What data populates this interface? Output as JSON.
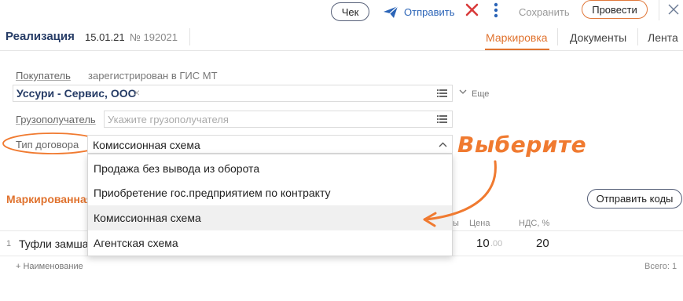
{
  "toolbar": {
    "check_label": "Чек",
    "send_label": "Отправить",
    "save_label": "Сохранить",
    "post_label": "Провести"
  },
  "doc": {
    "title": "Реализация",
    "date": "15.01.21",
    "number": "№ 192021"
  },
  "tabs": [
    "Маркировка",
    "Документы",
    "Лента"
  ],
  "form": {
    "buyer_label": "Покупатель",
    "buyer_status": "зарегистрирован в ГИС МТ",
    "buyer_value": "Уссури - Сервис, ООО",
    "more_label": "Еще",
    "consignee_label": "Грузополучатель",
    "consignee_placeholder": "Укажите грузополучателя",
    "contract_label": "Тип договора",
    "contract_value": "Комиссионная схема"
  },
  "dropdown": {
    "options": [
      "Продажа без вывода из оборота",
      "Приобретение гос.предприятием по контракту",
      "Комиссионная схема",
      "Агентская схема"
    ],
    "selected_index": 2
  },
  "annotation": "Выберите",
  "table": {
    "section_title": "Маркированная",
    "send_codes_label": "Отправить коды",
    "col_tail": "ы",
    "col_price": "Цена",
    "col_vat": "НДС, %",
    "row": {
      "num": "1",
      "name": "Туфли замша к",
      "price_int": "10",
      "price_dec": ".00",
      "vat": "20"
    },
    "add_label": "+ Наименование",
    "total_label": "Всего: 1"
  },
  "colors": {
    "accent": "#e0732f",
    "link": "#2b64b7",
    "title": "#263c66"
  }
}
